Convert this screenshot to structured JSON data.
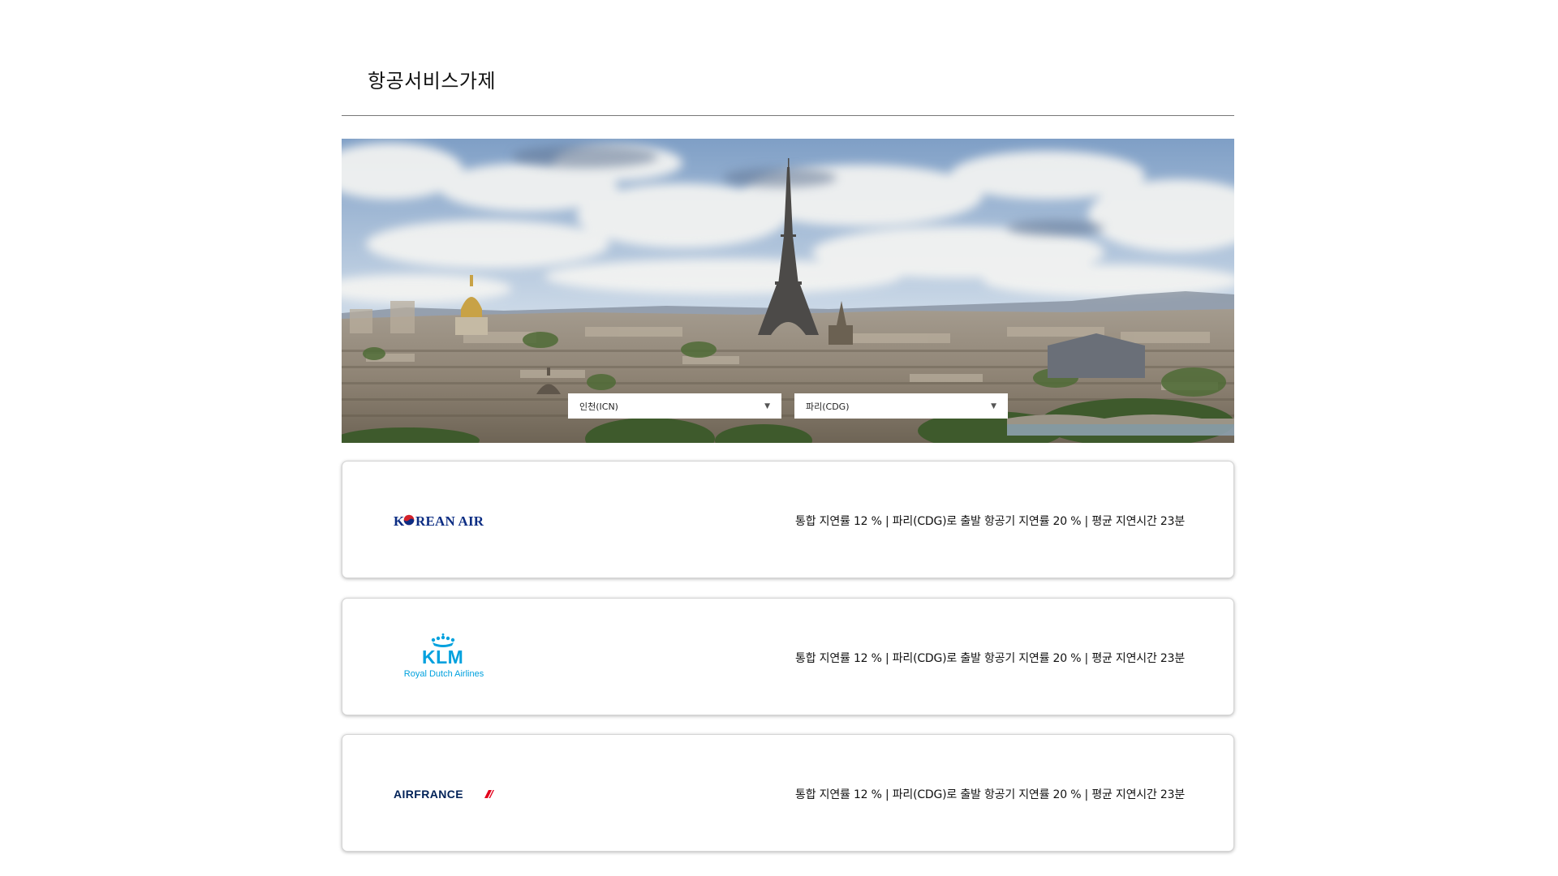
{
  "page": {
    "title": "항공서비스가제"
  },
  "route": {
    "origin": "인천(ICN)",
    "destination": "파리(CDG)",
    "dropdown_icon": "triangle-down-icon"
  },
  "hero": {
    "image": "paris-skyline-eiffel-tower"
  },
  "airlines": [
    {
      "name": "Korean Air",
      "logo_text": "KOREAN AIR",
      "stats": "통합 지연률 12 % | 파리(CDG)로 출발 항공기 지연률 20 % | 평균 지연시간 23분"
    },
    {
      "name": "KLM",
      "logo_text": "KLM",
      "logo_subtext": "Royal Dutch Airlines",
      "stats": "통합 지연률 12 % | 파리(CDG)로 출발 항공기 지연률 20 % | 평균 지연시간 23분"
    },
    {
      "name": "Air France",
      "logo_text": "AIRFRANCE",
      "stats": "통합 지연률 12 % | 파리(CDG)로 출발 항공기 지연률 20 % | 평균 지연시간 23분"
    }
  ],
  "colors": {
    "korean_air_blue": "#0c2d83",
    "korean_air_red": "#d4222a",
    "klm_blue": "#00a1de",
    "air_france_navy": "#002157",
    "air_france_red": "#e4001b"
  }
}
